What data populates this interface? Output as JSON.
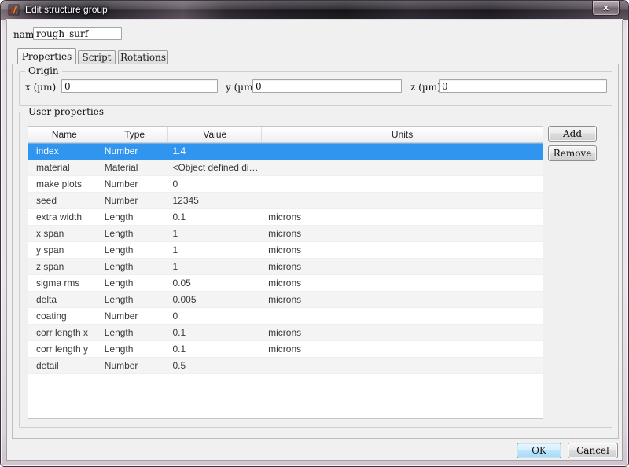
{
  "window": {
    "title": "Edit structure group",
    "close_label": "x"
  },
  "name_field": {
    "label": "name",
    "value": "rough_surf"
  },
  "tabs": [
    {
      "label": "Properties",
      "active": true
    },
    {
      "label": "Script",
      "active": false
    },
    {
      "label": "Rotations",
      "active": false
    }
  ],
  "origin": {
    "title": "Origin",
    "fields": [
      {
        "label": "x (µm)",
        "value": "0"
      },
      {
        "label": "y (µm)",
        "value": "0"
      },
      {
        "label": "z (µm)",
        "value": "0"
      }
    ]
  },
  "user_properties": {
    "title": "User properties",
    "columns": [
      "Name",
      "Type",
      "Value",
      "Units"
    ],
    "add_label": "Add",
    "remove_label": "Remove",
    "rows": [
      {
        "name": "index",
        "type": "Number",
        "value": "1.4",
        "units": "",
        "selected": true
      },
      {
        "name": "material",
        "type": "Material",
        "value": "<Object defined diel...",
        "units": "",
        "selected": false
      },
      {
        "name": "make plots",
        "type": "Number",
        "value": "0",
        "units": "",
        "selected": false
      },
      {
        "name": "seed",
        "type": "Number",
        "value": "12345",
        "units": "",
        "selected": false
      },
      {
        "name": "extra width",
        "type": "Length",
        "value": "0.1",
        "units": "microns",
        "selected": false
      },
      {
        "name": "x span",
        "type": "Length",
        "value": "1",
        "units": "microns",
        "selected": false
      },
      {
        "name": "y span",
        "type": "Length",
        "value": "1",
        "units": "microns",
        "selected": false
      },
      {
        "name": "z span",
        "type": "Length",
        "value": "1",
        "units": "microns",
        "selected": false
      },
      {
        "name": "sigma rms",
        "type": "Length",
        "value": "0.05",
        "units": "microns",
        "selected": false
      },
      {
        "name": "delta",
        "type": "Length",
        "value": "0.005",
        "units": "microns",
        "selected": false
      },
      {
        "name": "coating",
        "type": "Number",
        "value": "0",
        "units": "",
        "selected": false
      },
      {
        "name": "corr length x",
        "type": "Length",
        "value": "0.1",
        "units": "microns",
        "selected": false
      },
      {
        "name": "corr length y",
        "type": "Length",
        "value": "0.1",
        "units": "microns",
        "selected": false
      },
      {
        "name": "detail",
        "type": "Number",
        "value": "0.5",
        "units": "",
        "selected": false
      }
    ]
  },
  "footer": {
    "ok_label": "OK",
    "cancel_label": "Cancel"
  },
  "colors": {
    "selection_blue": "#3095ee",
    "default_button_border": "#3c7fb1",
    "client_background": "#f0f0f0",
    "icon_orange": "#f08223",
    "icon_red": "#cf2a1b"
  }
}
